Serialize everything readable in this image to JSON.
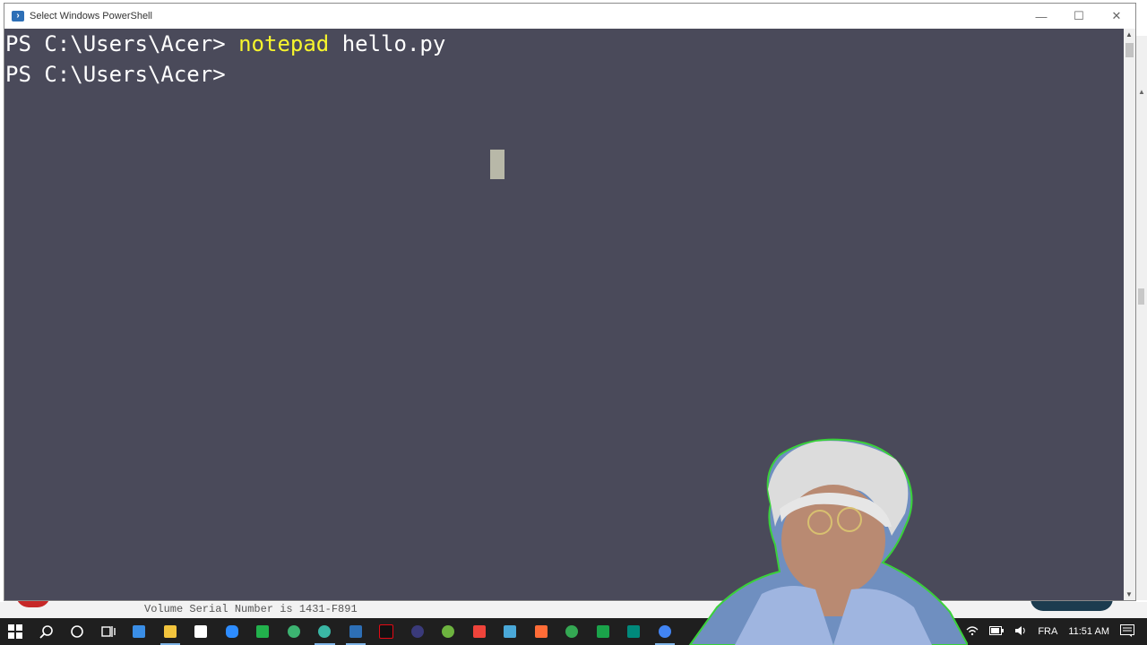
{
  "window": {
    "title": "Select Windows PowerShell",
    "controls": {
      "minimize": "—",
      "maximize": "☐",
      "close": "✕"
    }
  },
  "console": {
    "lines": [
      {
        "prompt": "PS C:\\Users\\Acer> ",
        "command": "notepad",
        "args": " hello.py"
      },
      {
        "prompt": "PS C:\\Users\\Acer>",
        "command": "",
        "args": ""
      }
    ],
    "colors": {
      "background": "#4a4a5a",
      "text": "#ffffff",
      "command": "#f7f52d"
    }
  },
  "background_window": {
    "status_text": "Volume Serial Number is 1431-F891"
  },
  "taskbar": {
    "icons": [
      {
        "name": "start-icon",
        "color": "#ffffff"
      },
      {
        "name": "search-icon",
        "color": "#ffffff"
      },
      {
        "name": "cortana-icon",
        "color": "#ffffff"
      },
      {
        "name": "task-view-icon",
        "color": "#ffffff"
      },
      {
        "name": "mail-icon",
        "color": "#3a8ee6"
      },
      {
        "name": "file-explorer-icon",
        "color": "#f2c43d"
      },
      {
        "name": "store-icon",
        "color": "#ffffff"
      },
      {
        "name": "zoom-icon",
        "color": "#2d8cff"
      },
      {
        "name": "green-app-icon",
        "color": "#22b14c"
      },
      {
        "name": "camera-icon",
        "color": "#3cb371"
      },
      {
        "name": "edge-icon",
        "color": "#3ab7a5"
      },
      {
        "name": "powershell-icon",
        "color": "#2d6fb6"
      },
      {
        "name": "netflix-icon",
        "color": "#e50914"
      },
      {
        "name": "eclipse-icon",
        "color": "#3a3a7a"
      },
      {
        "name": "spring-icon",
        "color": "#6db33f"
      },
      {
        "name": "anydesk-icon",
        "color": "#ef443b"
      },
      {
        "name": "skype-s-icon",
        "color": "#4aa8d8"
      },
      {
        "name": "postman-icon",
        "color": "#ff6c37"
      },
      {
        "name": "chrome-icon",
        "color": "#34a853"
      },
      {
        "name": "green-square-icon",
        "color": "#1aa34a"
      },
      {
        "name": "meet-icon",
        "color": "#00897b"
      },
      {
        "name": "chrome-2-icon",
        "color": "#4285f4"
      }
    ],
    "tray": {
      "language": "FRA",
      "time": "11:51 AM"
    }
  }
}
